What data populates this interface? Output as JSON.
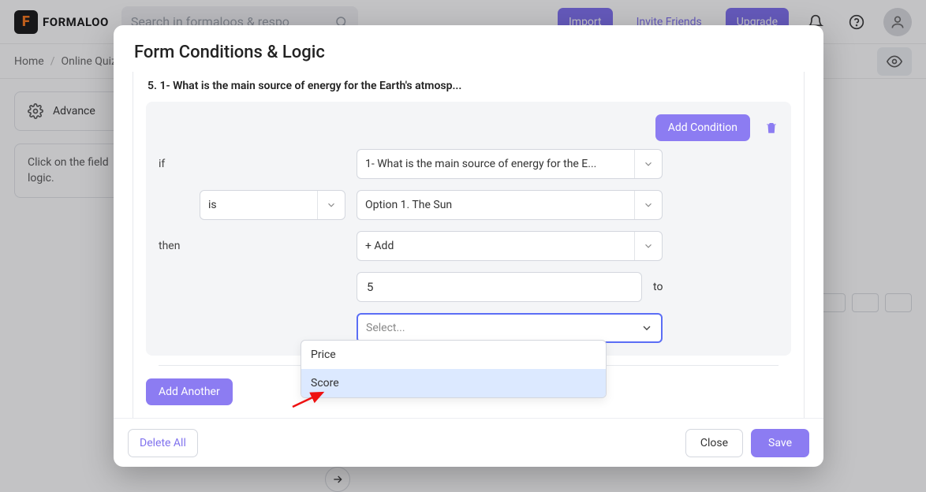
{
  "brand": "FORMALOO",
  "search_placeholder": "Search in formaloos & respo",
  "topbar": {
    "import": "Import",
    "invite": "Invite Friends",
    "upgrade": "Upgrade"
  },
  "breadcrumbs": {
    "home": "Home",
    "current": "Online Quiz"
  },
  "left_panel": {
    "advanced": "Advance",
    "hint": "Click on the field\nlogic."
  },
  "modal": {
    "title": "Form Conditions & Logic",
    "question_title": "5. 1- What is the main source of energy for the Earth's atmosp...",
    "add_condition": "Add Condition",
    "if_label": "if",
    "then_label": "then",
    "field_select": "1- What is the main source of energy for the E...",
    "operator": "is",
    "value_select": "Option 1. The Sun",
    "action_select": "+ Add",
    "number_value": "5",
    "to": "to",
    "target_placeholder": "Select...",
    "options": {
      "price": "Price",
      "score": "Score"
    },
    "add_another": "Add Another",
    "delete_all": "Delete All",
    "close": "Close",
    "save": "Save"
  },
  "colors": {
    "accent": "#8c7cf2",
    "focus": "#5b6ef5",
    "highlight": "#dce9ff"
  }
}
